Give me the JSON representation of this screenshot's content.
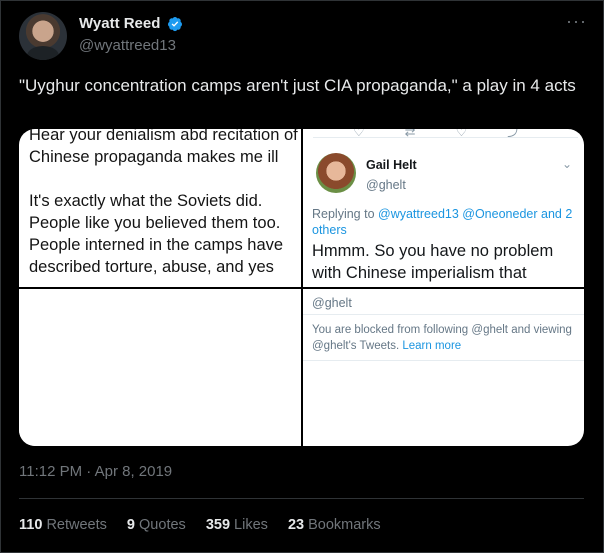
{
  "author": {
    "name": "Wyatt Reed",
    "handle": "@wyattreed13",
    "verified": true,
    "more_icon": "more-horizontal-icon"
  },
  "tweet": {
    "text": "\"Uyghur concentration camps aren't just CIA propaganda,\" a play in 4 acts",
    "timestamp": "11:12 PM · Apr 8, 2019"
  },
  "media": {
    "panel_left": {
      "para1": "Hear your denialism abd recitation of Chinese propaganda makes me ill",
      "para2": "It's exactly what the Soviets did. People like you believed them too. People interned in the camps have described torture, abuse, and yes"
    },
    "panel_right_top": {
      "name": "Gail Helt",
      "handle": "@ghelt",
      "replying_prefix": "Replying to ",
      "replying_links": "@wyattreed13 @Oneoneder and 2 others",
      "text": "Hmmm. So you have no problem with Chinese imperialism that"
    },
    "panel_right_bottom": {
      "handle": "@ghelt",
      "blocked_text": "You are blocked from following @ghelt and viewing @ghelt's Tweets. ",
      "learn_more": "Learn more"
    }
  },
  "stats": {
    "retweets_count": "110",
    "retweets_label": "Retweets",
    "quotes_count": "9",
    "quotes_label": "Quotes",
    "likes_count": "359",
    "likes_label": "Likes",
    "bookmarks_count": "23",
    "bookmarks_label": "Bookmarks"
  },
  "colors": {
    "background": "#000000",
    "verified": "#1d9bf0",
    "muted": "#71767b",
    "link": "#1b95e0"
  }
}
